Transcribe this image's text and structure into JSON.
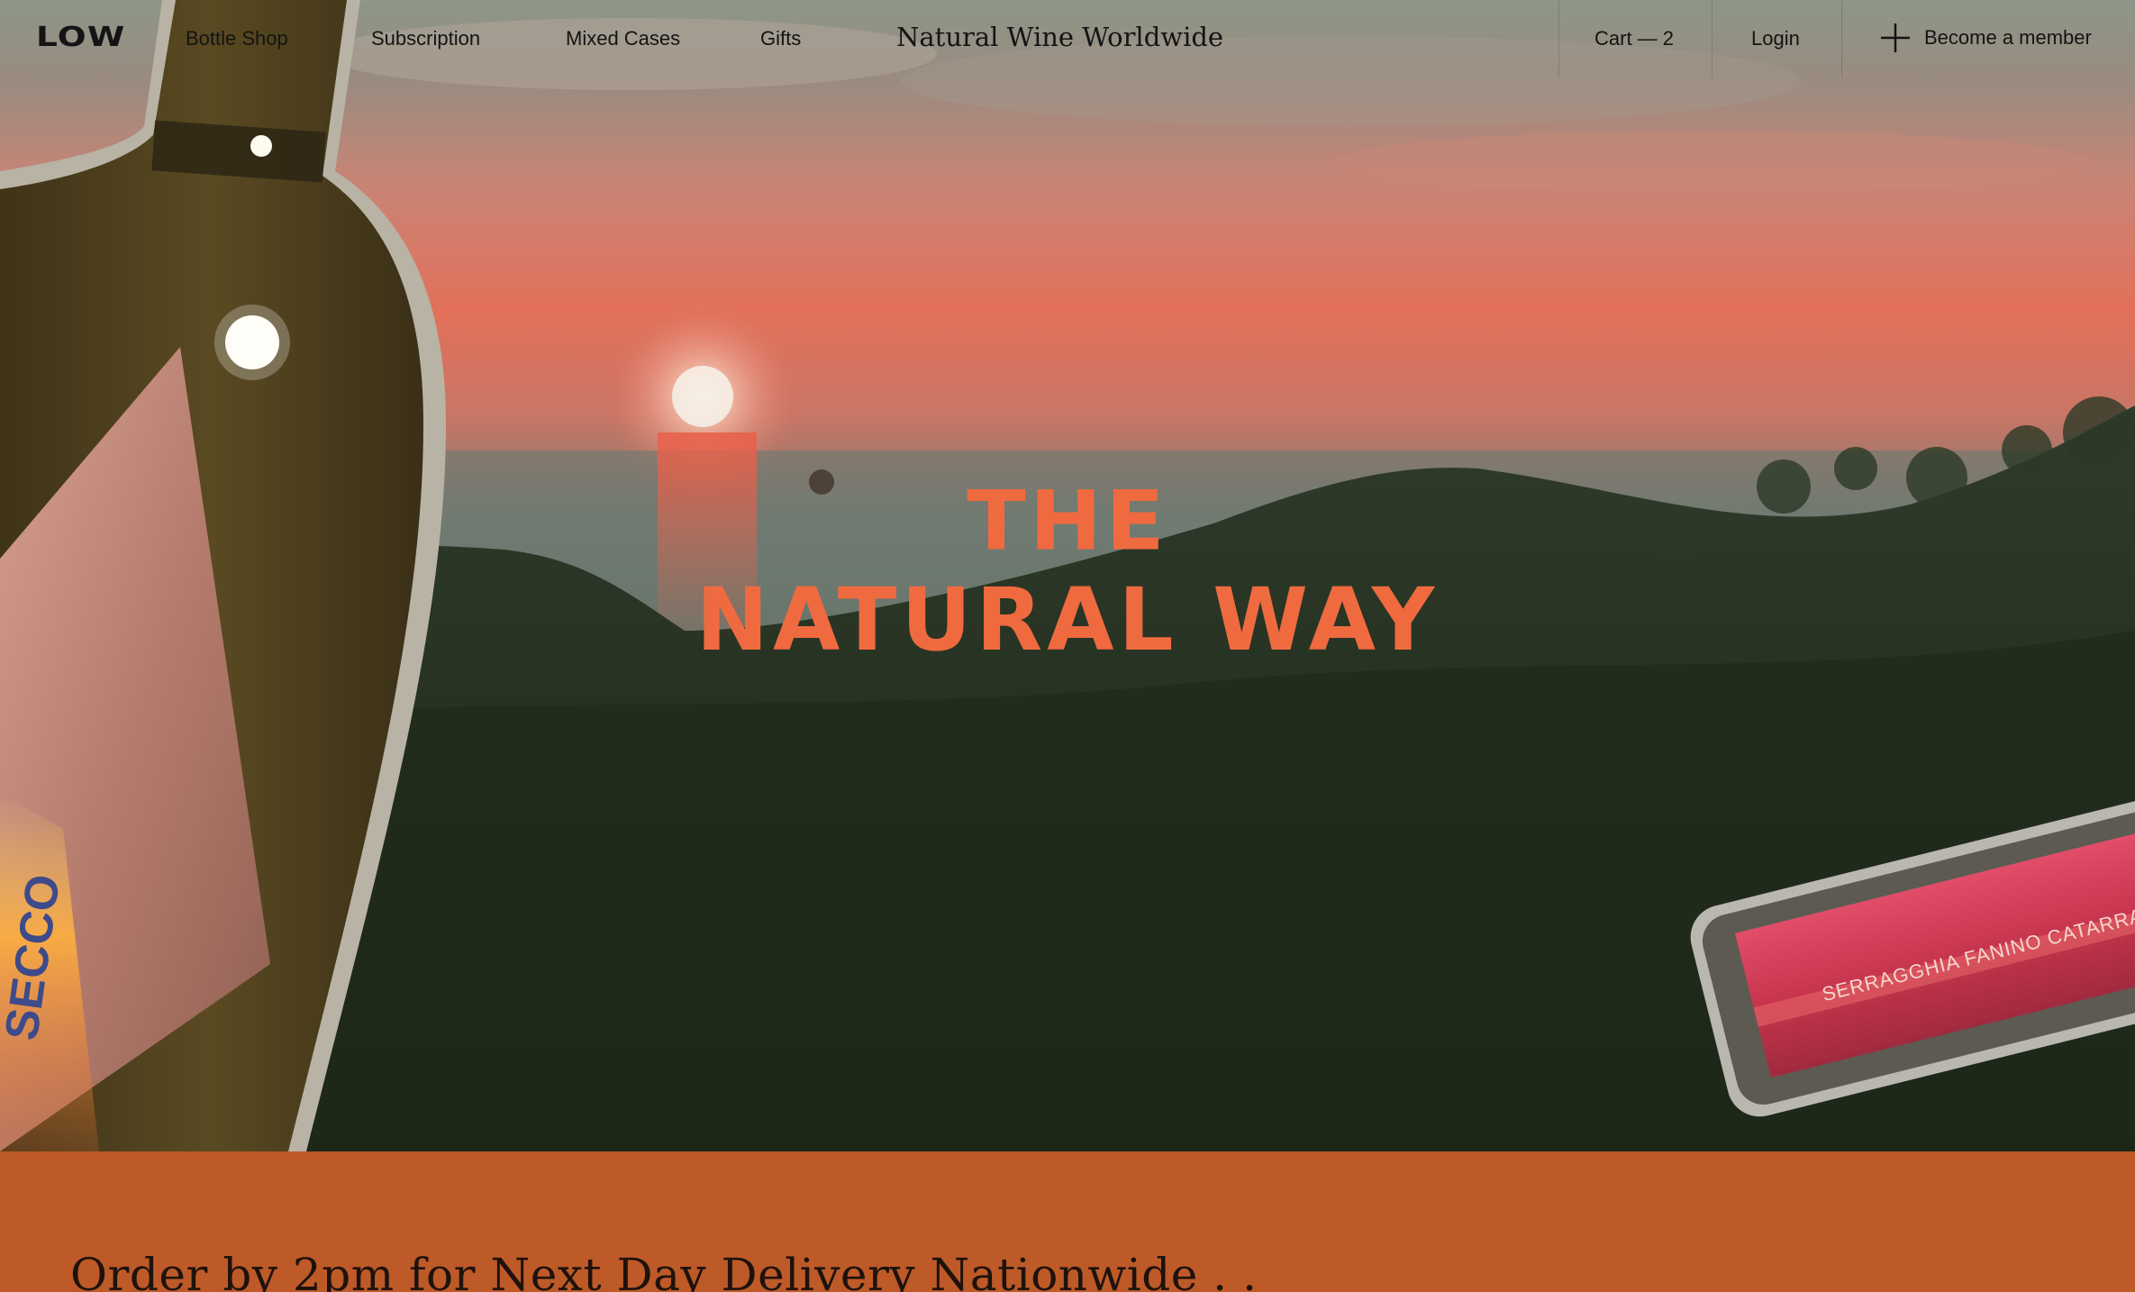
{
  "nav": {
    "logo": "LOW",
    "links": [
      "Bottle Shop",
      "Subscription",
      "Mixed Cases",
      "Gifts"
    ],
    "title": "Natural Wine Worldwide",
    "cart": "Cart — 2",
    "login": "Login",
    "member": "Become a member"
  },
  "hero": {
    "headline_line1": "THE",
    "headline_line2": "NATURAL WAY",
    "bottle_left_label": "SECCO",
    "bottle_right_label": "SERRAGGHIA FANINO CATARRA"
  },
  "banner": {
    "text": "Order by 2pm for Next Day Delivery Nationwide . ."
  },
  "colors": {
    "headline": "#f06a40",
    "banner": "#bd5a28",
    "nav_text": "#141414"
  },
  "icons": {
    "member": "plus-icon"
  }
}
